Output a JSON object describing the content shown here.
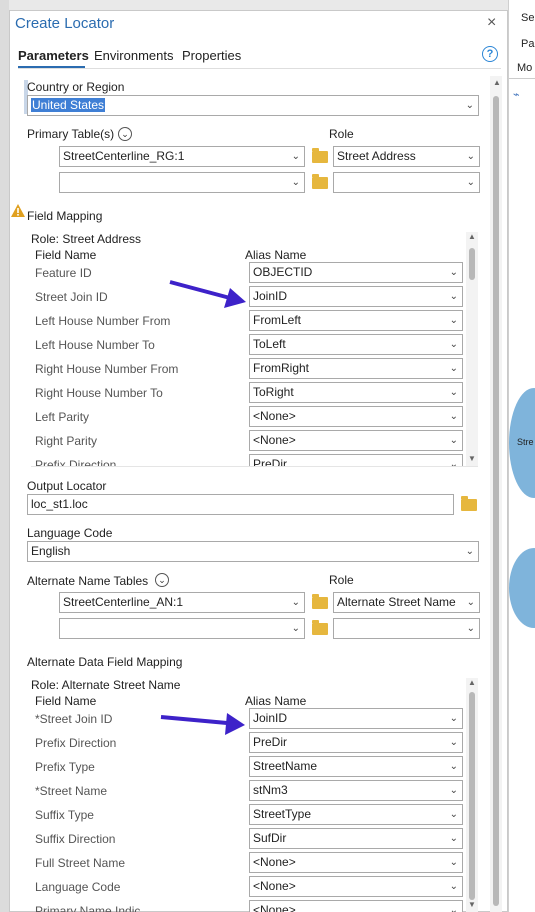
{
  "window": {
    "title": "Create Locator"
  },
  "tabs": [
    "Parameters",
    "Environments",
    "Properties"
  ],
  "help": "?",
  "close": "×",
  "country": {
    "label": "Country or Region",
    "value": "United States"
  },
  "primary": {
    "label": "Primary Table(s)",
    "role_label": "Role",
    "rows": [
      {
        "table": "StreetCenterline_RG:1",
        "role": "Street Address"
      },
      {
        "table": "",
        "role": ""
      }
    ]
  },
  "field_mapping": {
    "label": "Field Mapping",
    "role_line": "Role: Street Address",
    "col_field": "Field Name",
    "col_alias": "Alias Name",
    "rows": [
      {
        "field": "Feature ID",
        "alias": "OBJECTID"
      },
      {
        "field": "Street Join ID",
        "alias": "JoinID"
      },
      {
        "field": "Left House Number From",
        "alias": "FromLeft"
      },
      {
        "field": "Left House Number To",
        "alias": "ToLeft"
      },
      {
        "field": "Right House Number From",
        "alias": "FromRight"
      },
      {
        "field": "Right House Number To",
        "alias": "ToRight"
      },
      {
        "field": "Left Parity",
        "alias": "<None>"
      },
      {
        "field": "Right Parity",
        "alias": "<None>"
      },
      {
        "field": "Prefix Direction",
        "alias": "PreDir"
      }
    ]
  },
  "output": {
    "label": "Output Locator",
    "value": "loc_st1.loc"
  },
  "language": {
    "label": "Language Code",
    "value": "English"
  },
  "alternate": {
    "label": "Alternate Name Tables",
    "role_label": "Role",
    "rows": [
      {
        "table": "StreetCenterline_AN:1",
        "role": "Alternate Street Name"
      },
      {
        "table": "",
        "role": ""
      }
    ]
  },
  "alt_mapping": {
    "label": "Alternate Data Field Mapping",
    "role_line": "Role: Alternate Street Name",
    "col_field": "Field Name",
    "col_alias": "Alias Name",
    "rows": [
      {
        "field": "*Street Join ID",
        "alias": "JoinID"
      },
      {
        "field": "Prefix Direction",
        "alias": "PreDir"
      },
      {
        "field": "Prefix Type",
        "alias": "StreetName"
      },
      {
        "field": "*Street Name",
        "alias": "stNm3"
      },
      {
        "field": "Suffix Type",
        "alias": "StreetType"
      },
      {
        "field": "Suffix Direction",
        "alias": "SufDir"
      },
      {
        "field": "Full Street Name",
        "alias": "<None>"
      },
      {
        "field": "Language Code",
        "alias": "<None>"
      },
      {
        "field": "Primary Name Indic",
        "alias": "<None>"
      }
    ]
  },
  "bg_right": {
    "line1": "Sel",
    "line2": "Pa",
    "line3": "Mo",
    "blob_label": "Stre"
  },
  "colors": {
    "accent": "#2b6cb0",
    "arrow": "#3d22c9",
    "warning": "#e0a020"
  }
}
